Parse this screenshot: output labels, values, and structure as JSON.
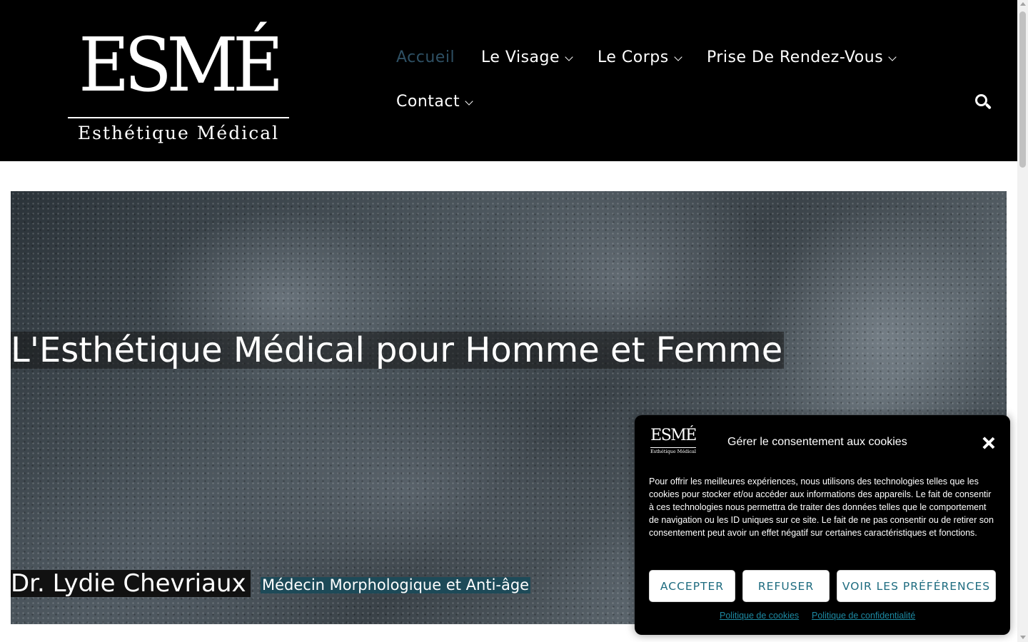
{
  "brand": {
    "wordmark": "ESMÉ",
    "tagline": "Esthétique Médical"
  },
  "nav": {
    "items": [
      {
        "label": "Accueil",
        "active": true
      },
      {
        "label": "Le Visage",
        "has_dropdown": true
      },
      {
        "label": "Le Corps",
        "has_dropdown": true
      },
      {
        "label": "Prise De Rendez-Vous",
        "has_dropdown": true
      },
      {
        "label": "Contact",
        "has_dropdown": true
      }
    ],
    "search_icon": "search-icon"
  },
  "hero": {
    "title": "L'Esthétique Médical pour Homme et Femme",
    "name": "Dr. Lydie Chevriaux",
    "role": "Médecin Morphologique et Anti-âge"
  },
  "cookie_banner": {
    "logo": {
      "wordmark": "ESMÉ",
      "tagline": "Esthétique Médical"
    },
    "title": "Gérer le consentement aux cookies",
    "text": "Pour offrir les meilleures expériences, nous utilisons des technologies telles que les cookies pour stocker et/ou accéder aux informations des appareils. Le fait de consentir à ces technologies nous permettra de traiter des données telles que le comportement de navigation ou les ID uniques sur ce site. Le fait de ne pas consentir ou de retirer son consentement peut avoir un effet négatif sur certaines caractéristiques et fonctions.",
    "buttons": {
      "accept": "ACCEPTER",
      "refuse": "REFUSER",
      "preferences": "VOIR LES PRÉFÉRENCES"
    },
    "links": {
      "cookie_policy": "Politique de cookies",
      "privacy_policy": "Politique de confidentialité"
    }
  },
  "colors": {
    "header_bg": "#000000",
    "nav_active": "#2e5064",
    "accent": "#1d6b7f",
    "role_bg": "#1d4a58"
  }
}
